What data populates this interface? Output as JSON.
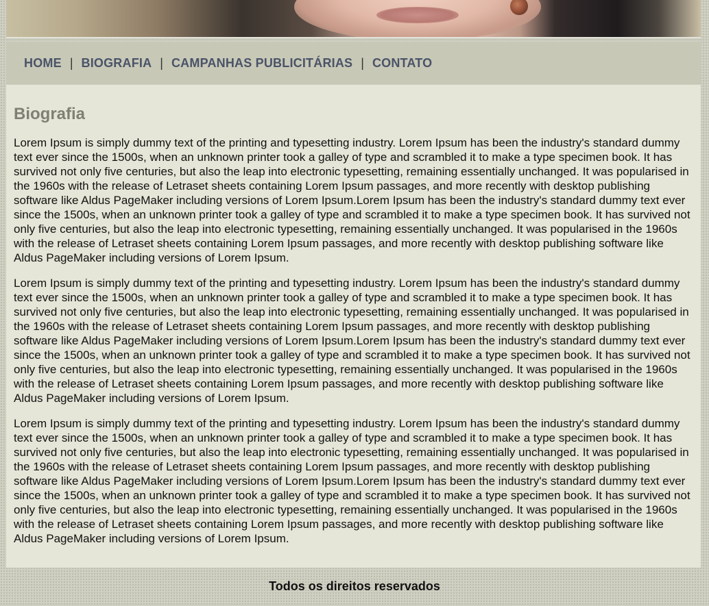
{
  "nav": {
    "items": [
      {
        "label": "HOME"
      },
      {
        "label": "BIOGRAFIA"
      },
      {
        "label": "CAMPANHAS PUBLICITÁRIAS"
      },
      {
        "label": "CONTATO"
      }
    ],
    "separator": "|"
  },
  "main": {
    "title": "Biografia",
    "paragraphs": [
      "Lorem Ipsum is simply dummy text of the printing and typesetting industry. Lorem Ipsum has been the industry's standard dummy text ever since the 1500s, when an unknown printer took a galley of type and scrambled it to make a type specimen book. It has survived not only five centuries, but also the leap into electronic typesetting, remaining essentially unchanged. It was popularised in the 1960s with the release of Letraset sheets containing Lorem Ipsum passages, and more recently with desktop publishing software like Aldus PageMaker including versions of Lorem Ipsum.Lorem Ipsum has been the industry's standard dummy text ever since the 1500s, when an unknown printer took a galley of type and scrambled it to make a type specimen book. It has survived not only five centuries, but also the leap into electronic typesetting, remaining essentially unchanged. It was popularised in the 1960s with the release of Letraset sheets containing Lorem Ipsum passages, and more recently with desktop publishing software like Aldus PageMaker including versions of Lorem Ipsum.",
      "Lorem Ipsum is simply dummy text of the printing and typesetting industry. Lorem Ipsum has been the industry's standard dummy text ever since the 1500s, when an unknown printer took a galley of type and scrambled it to make a type specimen book. It has survived not only five centuries, but also the leap into electronic typesetting, remaining essentially unchanged. It was popularised in the 1960s with the release of Letraset sheets containing Lorem Ipsum passages, and more recently with desktop publishing software like Aldus PageMaker including versions of Lorem Ipsum.Lorem Ipsum has been the industry's standard dummy text ever since the 1500s, when an unknown printer took a galley of type and scrambled it to make a type specimen book. It has survived not only five centuries, but also the leap into electronic typesetting, remaining essentially unchanged. It was popularised in the 1960s with the release of Letraset sheets containing Lorem Ipsum passages, and more recently with desktop publishing software like Aldus PageMaker including versions of Lorem Ipsum.",
      "Lorem Ipsum is simply dummy text of the printing and typesetting industry. Lorem Ipsum has been the industry's standard dummy text ever since the 1500s, when an unknown printer took a galley of type and scrambled it to make a type specimen book. It has survived not only five centuries, but also the leap into electronic typesetting, remaining essentially unchanged. It was popularised in the 1960s with the release of Letraset sheets containing Lorem Ipsum passages, and more recently with desktop publishing software like Aldus PageMaker including versions of Lorem Ipsum.Lorem Ipsum has been the industry's standard dummy text ever since the 1500s, when an unknown printer took a galley of type and scrambled it to make a type specimen book. It has survived not only five centuries, but also the leap into electronic typesetting, remaining essentially unchanged. It was popularised in the 1960s with the release of Letraset sheets containing Lorem Ipsum passages, and more recently with desktop publishing software like Aldus PageMaker including versions of Lorem Ipsum."
    ]
  },
  "footer": {
    "text": "Todos os direitos reservados"
  },
  "colors": {
    "nav_link": "#4a5368",
    "nav_background": "#c7c8b6",
    "content_background": "#e5e6d7",
    "title": "#807f73"
  }
}
